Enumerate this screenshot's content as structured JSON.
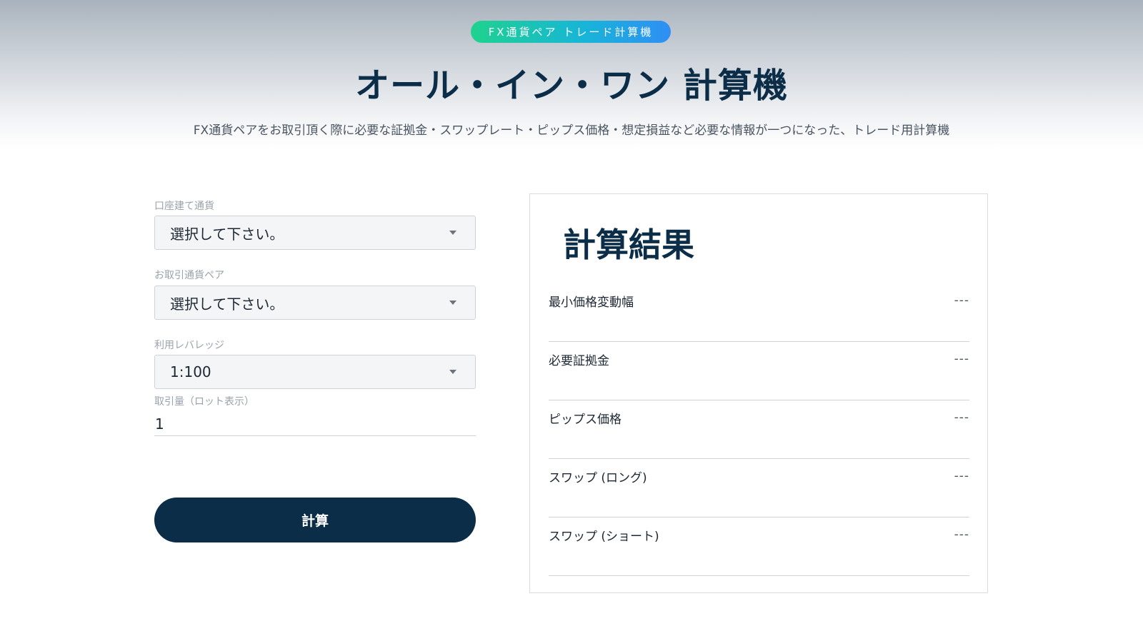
{
  "header": {
    "badge": "FX通貨ペア トレード計算機",
    "title": "オール・イン・ワン 計算機",
    "description": "FX通貨ペアをお取引頂く際に必要な証拠金・スワップレート・ピップス価格・想定損益など必要な情報が一つになった、トレード用計算機"
  },
  "form": {
    "account_currency": {
      "label": "口座建て通貨",
      "value": "選択して下さい。"
    },
    "currency_pair": {
      "label": "お取引通貨ペア",
      "value": "選択して下さい。"
    },
    "leverage": {
      "label": "利用レバレッジ",
      "value": "1:100"
    },
    "lot": {
      "label": "取引量（ロット表示）",
      "value": "1"
    },
    "calculate_label": "計算"
  },
  "results": {
    "title": "計算結果",
    "rows": [
      {
        "label": "最小価格変動幅",
        "value": "---"
      },
      {
        "label": "必要証拠金",
        "value": "---"
      },
      {
        "label": "ピップス価格",
        "value": "---"
      },
      {
        "label": "スワップ (ロング)",
        "value": "---"
      },
      {
        "label": "スワップ (ショート)",
        "value": "---"
      }
    ]
  },
  "colors": {
    "navy": "#0c2d48",
    "badge_gradient_start": "#1fd28e",
    "badge_gradient_end": "#2f8ef5"
  },
  "icons": [
    "chevron-down-icon"
  ]
}
